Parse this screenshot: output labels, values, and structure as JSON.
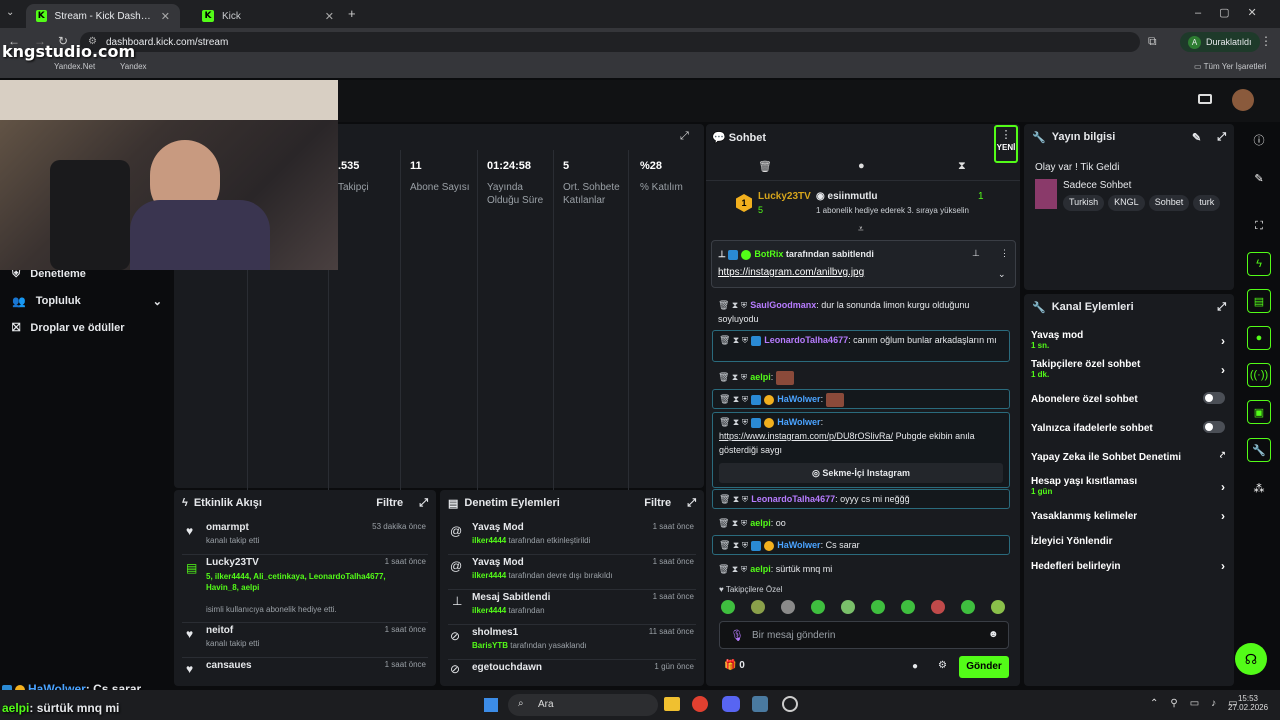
{
  "browser": {
    "tabs": [
      {
        "label": "Stream - Kick Dashboard"
      },
      {
        "label": "Kick"
      }
    ],
    "url": "dashboard.kick.com/stream",
    "profile_label": "Duraklatıldı",
    "bookmarks": [
      "Yandex.Net",
      "Yandex"
    ],
    "bookmarks_right": "Tüm Yer İşaretleri"
  },
  "watermark": "kngstudio.com",
  "sidebar": {
    "items": [
      {
        "label": "Denetleme"
      },
      {
        "label": "Topluluk"
      },
      {
        "label": "Droplar ve ödüller"
      }
    ]
  },
  "stats": [
    {
      "value": ".535",
      "label": "Takipçi"
    },
    {
      "value": "11",
      "label": "Abone Sayısı"
    },
    {
      "value": "01:24:58",
      "label": "Yayında Olduğu Süre"
    },
    {
      "value": "5",
      "label": "Ort. Sohbete Katılanlar"
    },
    {
      "value": "%28",
      "label": "% Katılım"
    }
  ],
  "activity": {
    "title": "Etkinlik Akışı",
    "filter": "Filtre",
    "items": [
      {
        "user": "omarmpt",
        "time": "53 dakika önce",
        "desc": "kanalı takip etti"
      },
      {
        "user": "Lucky23TV",
        "time": "1 saat önce",
        "names": "5, ilker4444, Ali_cetinkaya, LeonardoTalha4677, Havin_8, aelpi",
        "desc": "isimli kullanıcıya abonelik hediye etti."
      },
      {
        "user": "neitof",
        "time": "1 saat önce",
        "desc": "kanalı takip etti"
      },
      {
        "user": "cansaues",
        "time": "1 saat önce",
        "desc": ""
      }
    ]
  },
  "modlog": {
    "title": "Denetim Eylemleri",
    "filter": "Filtre",
    "items": [
      {
        "action": "Yavaş Mod",
        "time": "1 saat önce",
        "actor": "ilker4444",
        "desc": "tarafından etkinleştirildi"
      },
      {
        "action": "Yavaş Mod",
        "time": "1 saat önce",
        "actor": "ilker4444",
        "desc": "tarafından devre dışı bırakıldı"
      },
      {
        "action": "Mesaj Sabitlendi",
        "time": "1 saat önce",
        "actor": "ilker4444",
        "desc": "tarafından"
      },
      {
        "action": "sholmes1",
        "time": "11 saat önce",
        "actor": "BarisYTB",
        "desc": "tarafından yasaklandı"
      },
      {
        "action": "egetouchdawn",
        "time": "1 gün önce",
        "actor": "",
        "desc": ""
      }
    ]
  },
  "chat": {
    "title": "Sohbet",
    "new_badge": "YENİ",
    "gift": {
      "user": "Lucky23TV",
      "count": "5",
      "target": "esiinmutlu",
      "target_count": "1",
      "note": "1 abonelik hediye ederek 3. sıraya yükselin"
    },
    "pinned": {
      "by": "BotRix",
      "by_suffix": "tarafından sabitlendi",
      "link": "https://instagram.com/anilbvg.jpg"
    },
    "messages": [
      {
        "user": "SaulGoodmanx",
        "text": ": dur la sonunda limon kurgu olduğunu soyluyodu",
        "color": "#b77cff"
      },
      {
        "user": "LeonardoTalha4677",
        "text": ": canım oğlum bunlar arkadaşların mı",
        "color": "#b77cff"
      },
      {
        "user": "aelpi",
        "text": ":",
        "color": "#53fc18"
      },
      {
        "user": "HaWolwer",
        "text": ":",
        "color": "#4aa3ff"
      },
      {
        "user": "HaWolwer",
        "text": ":",
        "color": "#4aa3ff",
        "link": "https://www.instagram.com/p/DU8rOSlivRa/",
        "after": " Pubgde ekibin anıla gösterdiği saygı",
        "embed": "Sekme-İçi Instagram"
      },
      {
        "user": "LeonardoTalha4677",
        "text": ": oyyy cs mi neğğğ",
        "color": "#b77cff"
      },
      {
        "user": "aelpi",
        "text": ": oo",
        "color": "#53fc18"
      },
      {
        "user": "HaWolwer",
        "text": ": Cs sarar",
        "color": "#4aa3ff"
      },
      {
        "user": "aelpi",
        "text": ": sürtük mnq mi",
        "color": "#53fc18"
      }
    ],
    "followers_only": "Takipçilere Özel",
    "input_placeholder": "Bir mesaj gönderin",
    "count": "0",
    "send_label": "Gönder"
  },
  "stream_info": {
    "title": "Yayın bilgisi",
    "stream_title": "Olay var ! Tik Geldi",
    "category": "Sadece Sohbet",
    "tags": [
      "Turkish",
      "KNGL",
      "Sohbet",
      "turk"
    ]
  },
  "channel_actions": {
    "title": "Kanal Eylemleri",
    "items": [
      {
        "label": "Yavaş mod",
        "sub": "1 sn.",
        "control": "chevron"
      },
      {
        "label": "Takipçilere özel sohbet",
        "sub": "1 dk.",
        "control": "chevron"
      },
      {
        "label": "Abonelere özel sohbet",
        "sub": "",
        "control": "toggle"
      },
      {
        "label": "Yalnızca ifadelerle sohbet",
        "sub": "",
        "control": "toggle"
      },
      {
        "label": "Yapay Zeka ile Sohbet Denetimi",
        "sub": "",
        "control": "external"
      },
      {
        "label": "Hesap yaşı kısıtlaması",
        "sub": "1 gün",
        "control": "chevron"
      },
      {
        "label": "Yasaklanmış kelimeler",
        "sub": "",
        "control": "chevron"
      },
      {
        "label": "İzleyici Yönlendir",
        "sub": "",
        "control": "none"
      },
      {
        "label": "Hedefleri belirleyin",
        "sub": "",
        "control": "chevron"
      }
    ]
  },
  "overlay": [
    {
      "user": "HaWolwer",
      "text": ": Cs sarar"
    },
    {
      "user": "aelpi",
      "text": ": sürtük mnq mi"
    }
  ],
  "taskbar": {
    "search": "Ara",
    "time": "15:53",
    "date": "27.02.2026"
  },
  "colors": {
    "accent": "#53fc18",
    "panel": "#191b1f",
    "bg": "#0b0c0e"
  }
}
